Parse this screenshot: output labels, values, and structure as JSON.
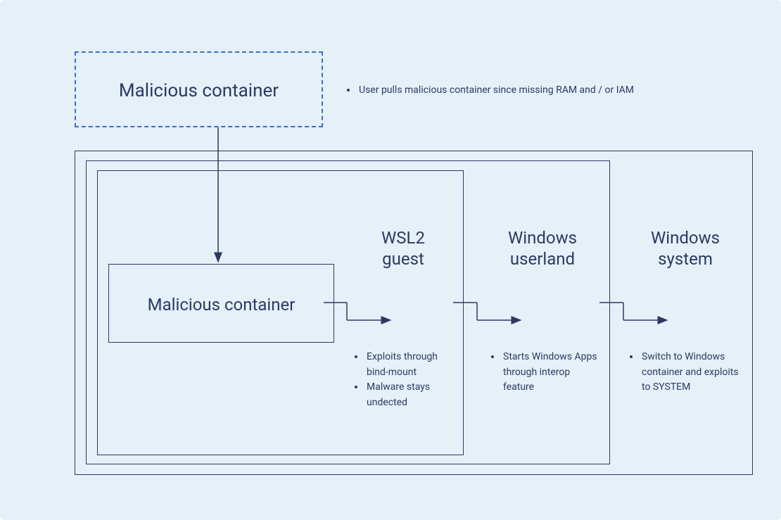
{
  "top": {
    "malicious_container_label": "Malicious container",
    "bullet": "User pulls malicious container  since missing RAM and / or IAM"
  },
  "inner": {
    "malicious_container_label": "Malicious container"
  },
  "stages": {
    "wsl2_guest": {
      "title_line1": "WSL2",
      "title_line2": "guest",
      "bullets": [
        "Exploits through bind-mount",
        "Malware stays undected"
      ]
    },
    "windows_userland": {
      "title_line1": "Windows",
      "title_line2": "userland",
      "bullets": [
        "Starts Windows Apps through interop feature"
      ]
    },
    "windows_system": {
      "title_line1": "Windows",
      "title_line2": "system",
      "bullets": [
        "Switch to Windows container and exploits to SYSTEM"
      ]
    }
  }
}
